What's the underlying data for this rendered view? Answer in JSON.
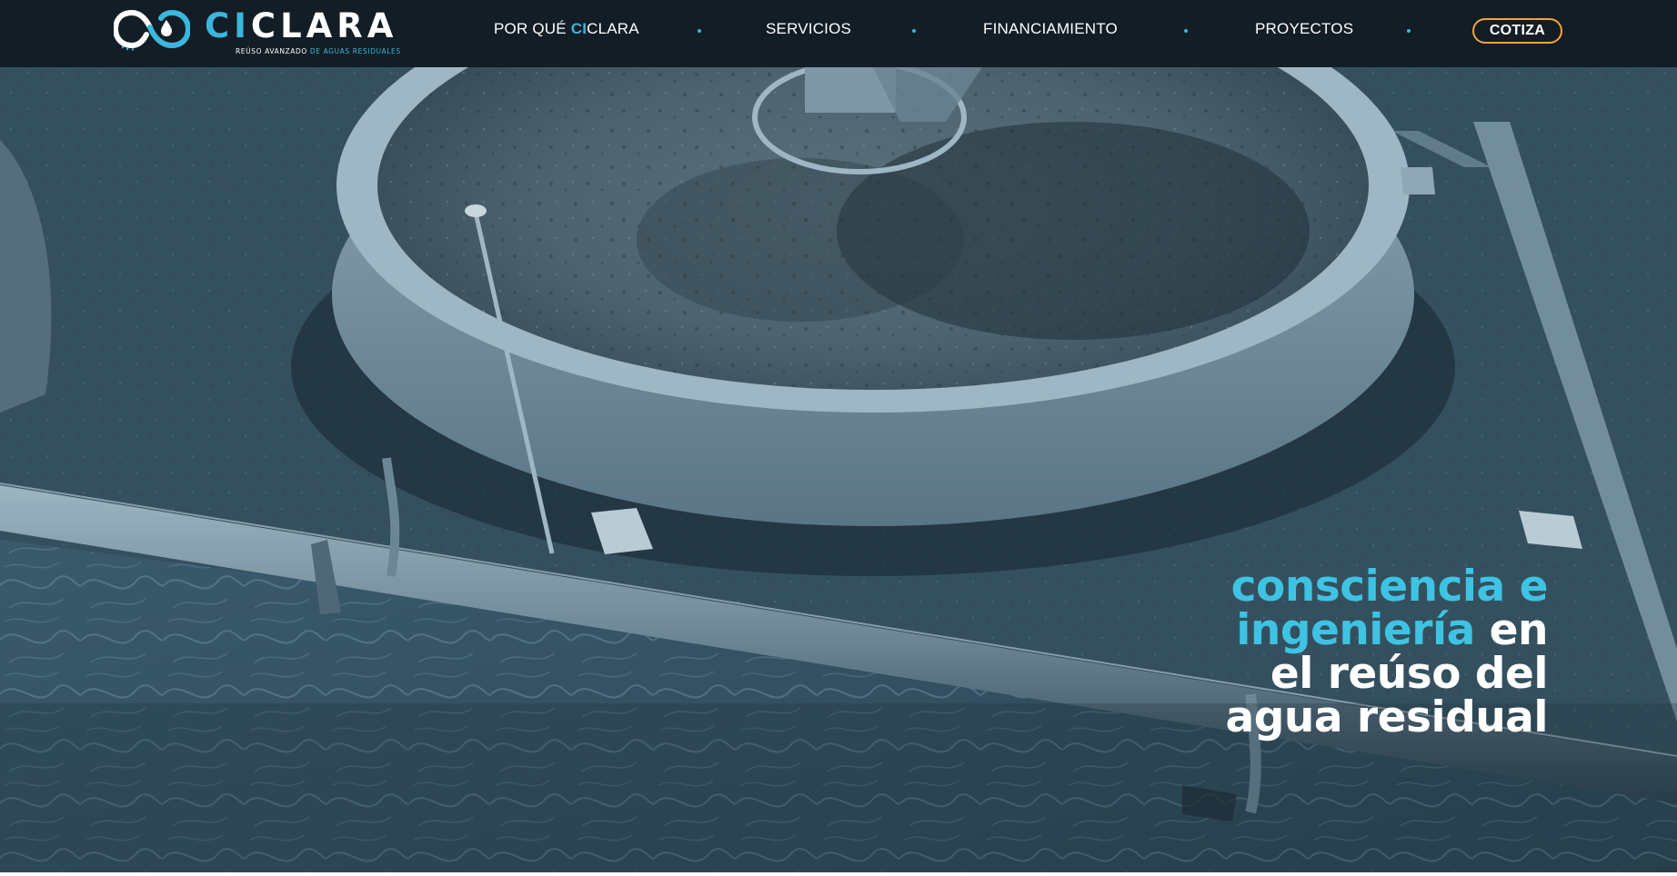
{
  "brand": {
    "name_accent": "CI",
    "name_rest": "CLARA",
    "tagline_part1": "REÚSO AVANZADO",
    "tagline_part2": "DE AGUAS RESIDUALES",
    "accent_color": "#3bb6dc",
    "logo_icon": "water-cycle-logo-icon"
  },
  "nav": {
    "items": [
      {
        "label_pre": "POR QUÉ ",
        "label_hl": "CI",
        "label_post": "CLARA"
      },
      {
        "label": "SERVICIOS"
      },
      {
        "label": "FINANCIAMIENTO"
      },
      {
        "label": "PROYECTOS"
      }
    ],
    "separator": "dot",
    "cta_label": "COTIZA",
    "cta_border_color": "#f2a43a",
    "background_color": "#131d25"
  },
  "hero": {
    "headline_accent_1": "consciencia e",
    "headline_accent_2": "ingeniería",
    "headline_white_2": " en",
    "headline_line_3": "el reúso del",
    "headline_line_4": "agua residual",
    "accent_color": "#3ec3e3",
    "background_image": "aerial view of circular wastewater clarifier tank with pipeline, blue duotone"
  }
}
